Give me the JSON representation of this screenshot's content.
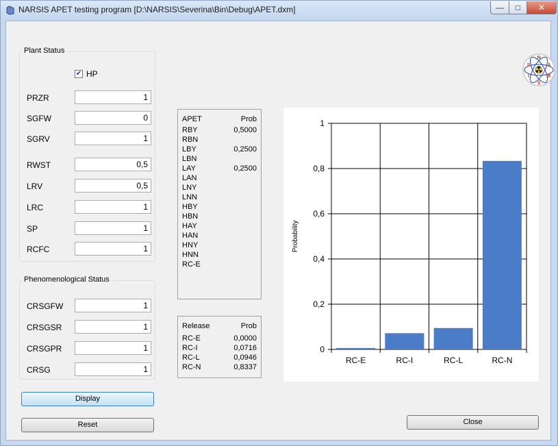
{
  "window": {
    "title": "NARSIS APET testing program [D:\\NARSIS\\Severina\\Bin\\Debug\\APET.dxm]"
  },
  "plant_status": {
    "label": "Plant Status",
    "hp": {
      "label": "HP",
      "checked": true
    },
    "fields": [
      {
        "label": "PRZR",
        "value": "1"
      },
      {
        "label": "SGFW",
        "value": "0"
      },
      {
        "label": "SGRV",
        "value": "1"
      },
      {
        "label": "RWST",
        "value": "0,5"
      },
      {
        "label": "LRV",
        "value": "0,5"
      },
      {
        "label": "LRC",
        "value": "1"
      },
      {
        "label": "SP",
        "value": "1"
      },
      {
        "label": "RCFC",
        "value": "1"
      }
    ]
  },
  "phenomenological_status": {
    "label": "Phenomenological Status",
    "fields": [
      {
        "label": "CRSGFW",
        "value": "1"
      },
      {
        "label": "CRSGSR",
        "value": "1"
      },
      {
        "label": "CRSGPR",
        "value": "1"
      },
      {
        "label": "CRSG",
        "value": "1"
      }
    ]
  },
  "apet_table": {
    "headers": [
      "APET",
      "Prob"
    ],
    "rows": [
      [
        "RBY",
        "0,5000"
      ],
      [
        "RBN",
        ""
      ],
      [
        "LBY",
        "0,2500"
      ],
      [
        "LBN",
        ""
      ],
      [
        "LAY",
        "0,2500"
      ],
      [
        "LAN",
        ""
      ],
      [
        "LNY",
        ""
      ],
      [
        "LNN",
        ""
      ],
      [
        "HBY",
        ""
      ],
      [
        "HBN",
        ""
      ],
      [
        "HAY",
        ""
      ],
      [
        "HAN",
        ""
      ],
      [
        "HNY",
        ""
      ],
      [
        "HNN",
        ""
      ],
      [
        "RC-E",
        ""
      ]
    ]
  },
  "release_table": {
    "headers": [
      "Release",
      "Prob"
    ],
    "rows": [
      [
        "RC-E",
        "0,0000"
      ],
      [
        "RC-I",
        "0,0716"
      ],
      [
        "RC-L",
        "0,0946"
      ],
      [
        "RC-N",
        "0,8337"
      ]
    ]
  },
  "buttons": {
    "display": "Display",
    "reset": "Reset",
    "close": "Close"
  },
  "logo_letters": [
    "N",
    "A",
    "R",
    "S",
    "I",
    "S"
  ],
  "colors": {
    "bar": "#4a7cc7",
    "titlebar": "#c7d9ef",
    "close_button": "#c74a33"
  },
  "chart_data": {
    "type": "bar",
    "categories": [
      "RC-E",
      "RC-I",
      "RC-L",
      "RC-N"
    ],
    "values": [
      0.0,
      0.0716,
      0.0946,
      0.8337
    ],
    "ylabel": "Probability",
    "xlabel": "",
    "ylim": [
      0,
      1
    ],
    "yticks": [
      0,
      0.2,
      0.4,
      0.6,
      0.8,
      1
    ],
    "ytick_labels": [
      "0",
      "0,2",
      "0,4",
      "0,6",
      "0,8",
      "1"
    ],
    "grid": true,
    "legend": "none"
  }
}
